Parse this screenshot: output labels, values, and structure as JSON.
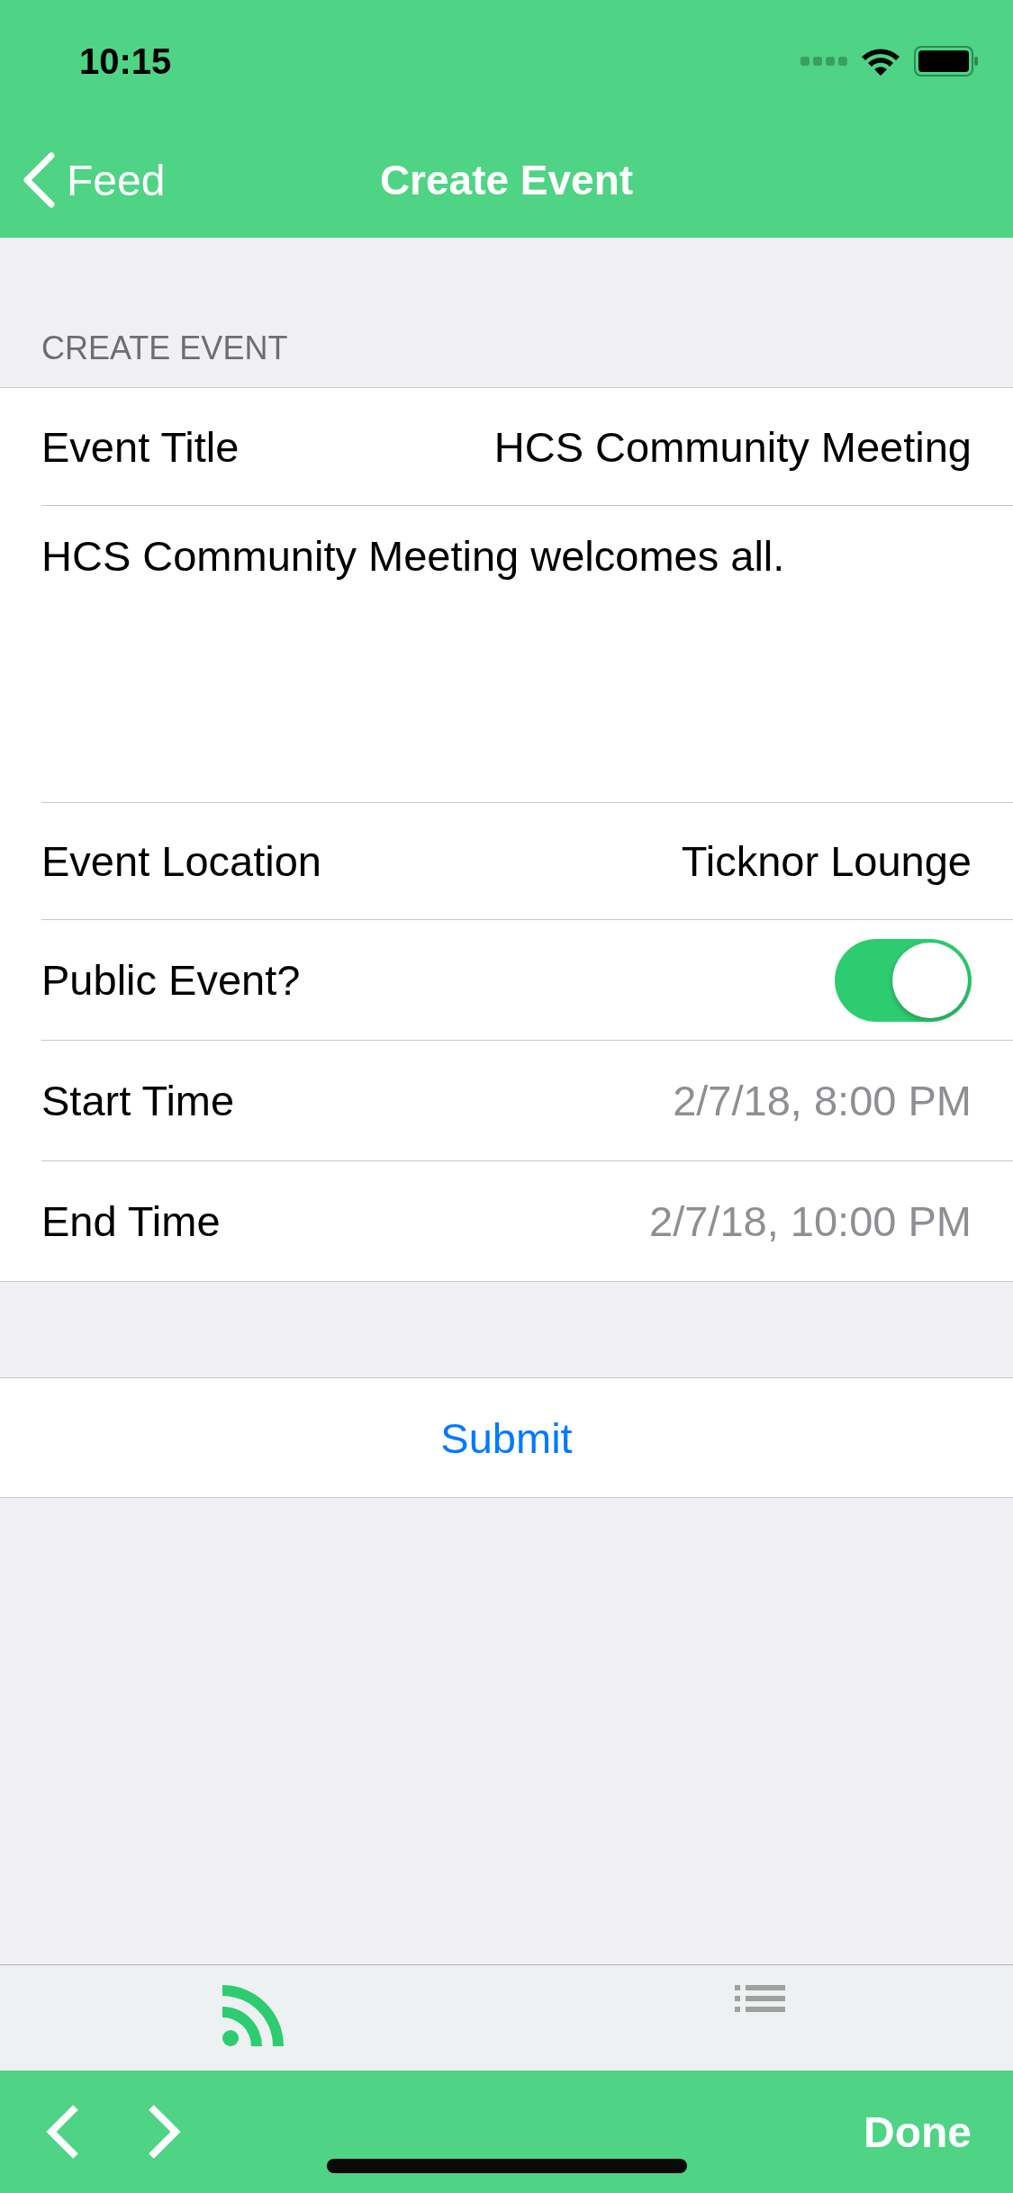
{
  "status_bar": {
    "time": "10:15"
  },
  "nav_bar": {
    "back": "Feed",
    "title": "Create Event"
  },
  "section_header": "CREATE EVENT",
  "rows": [
    {
      "kind": "field",
      "label": "Event Title",
      "value": "HCS Community Meeting"
    },
    {
      "kind": "textarea",
      "value": "HCS Community Meeting welcomes all."
    },
    {
      "kind": "field",
      "label": "Event Location",
      "value": "Ticknor Lounge"
    },
    {
      "kind": "toggle",
      "label": "Public Event?",
      "on": true
    },
    {
      "kind": "date",
      "label": "Start Time",
      "value": "2/7/18, 8:00 PM"
    },
    {
      "kind": "date",
      "label": "End Time",
      "value": "2/7/18, 10:00 PM"
    }
  ],
  "submit": "Submit",
  "tab_bar": [
    {
      "selected": true
    },
    {
      "selected": false
    }
  ],
  "toolbar": {
    "done": "Done"
  }
}
